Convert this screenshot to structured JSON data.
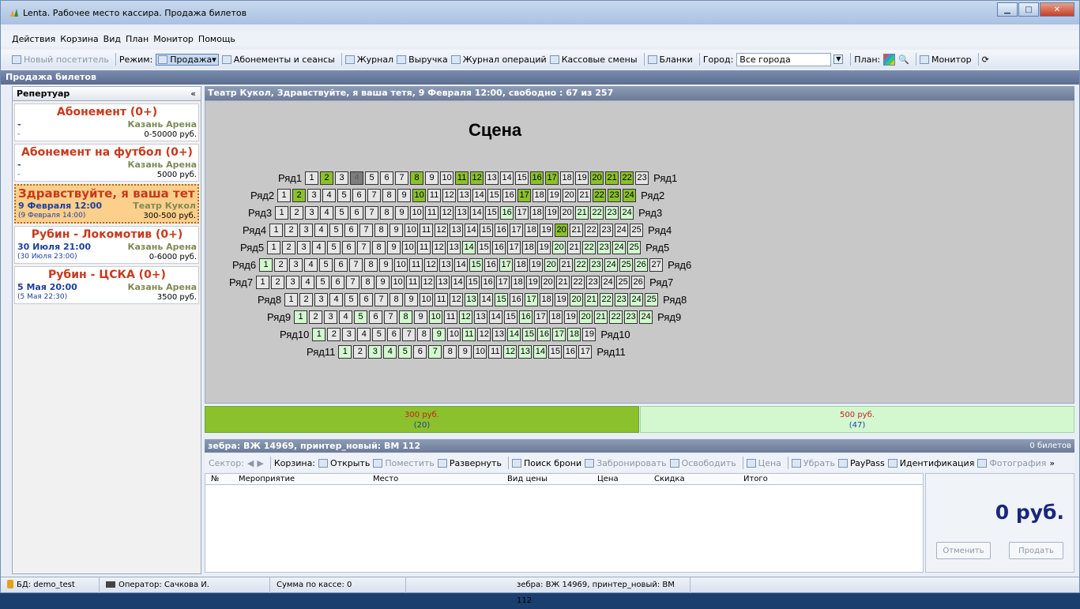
{
  "window": {
    "title": "Lenta. Рабочее место кассира. Продажа билетов"
  },
  "menu": [
    "Действия",
    "Корзина",
    "Вид",
    "План",
    "Монитор",
    "Помощь"
  ],
  "toolbar": {
    "new_visitor": "Новый посетитель",
    "mode_label": "Режим:",
    "mode_value": "Продажа",
    "subscriptions": "Абонементы и сеансы",
    "journal": "Журнал",
    "revenue": "Выручка",
    "ops_journal": "Журнал операций",
    "shifts": "Кассовые смены",
    "forms": "Бланки",
    "city_label": "Город:",
    "city_value": "Все города",
    "plan_label": "План:",
    "monitor": "Монитор"
  },
  "section_title": "Продажа билетов",
  "repertoire": {
    "title": "Репертуар",
    "collapse": "«",
    "items": [
      {
        "name": "Абонемент (0+)",
        "venue": "Казань Арена",
        "date": "-",
        "sub": "-",
        "price": "0-50000 руб."
      },
      {
        "name": "Абонемент на футбол (0+)",
        "venue": "Казань Арена",
        "date": "-",
        "sub": "-",
        "price": "5000 руб."
      },
      {
        "name": "Здравствуйте, я ваша тет...",
        "venue": "Театр Кукол",
        "date": "9 Февраля 12:00",
        "sub": "(9 Февраля 14:00)",
        "price": "300-500 руб.",
        "selected": true
      },
      {
        "name": "Рубин - Локомотив (0+)",
        "venue": "Казань Арена",
        "date": "30 Июля 21:00",
        "sub": "(30 Июля 23:00)",
        "price": "0-6000 руб."
      },
      {
        "name": "Рубин - ЦСКА (0+)",
        "venue": "Казань Арена",
        "date": "5 Мая 20:00",
        "sub": "(5 Мая 22:30)",
        "price": "3500 руб."
      }
    ]
  },
  "hall": {
    "header": "Театр Кукол, Здравствуйте, я ваша тетя, 9 Февраля 12:00, свободно : 67 из 257",
    "scene": "Сцена",
    "rows": [
      {
        "label": "Ряд1",
        "seats": "ngnxnnngnnggnnnggnngggn"
      },
      {
        "label": "Ряд2",
        "seats": "ngnnnnnnngnnnnnngnnnnggg"
      },
      {
        "label": "Ряд3",
        "seats": "nnnnnnnnnnnnnnnlnnnnllll"
      },
      {
        "label": "Ряд4",
        "seats": "nnnnnnnnnnnnnnnnnnngnnnnn"
      },
      {
        "label": "Ряд5",
        "seats": "nnnnnnnnnnnnnlnnnnnlnllll"
      },
      {
        "label": "Ряд6",
        "seats": "lnnnnnnnnnnnnnlnlnnlnllllln"
      },
      {
        "label": "Ряд7",
        "seats": "nnnnnnnnnnnnnnnnnnnnnnnnnn"
      },
      {
        "label": "Ряд8",
        "seats": "nnnnnnnnnnnnlnlnlnnllllll"
      },
      {
        "label": "Ряд9",
        "seats": "lnnnlnnlnlnlnnnlnnnlllll"
      },
      {
        "label": "Ряд10",
        "seats": "lnnnnnnnlnlnnllllln"
      },
      {
        "label": "Ряд11",
        "seats": "lnlllnlnnnnlllnnn"
      }
    ]
  },
  "prices": [
    {
      "value": "300 руб.",
      "count": "(20)",
      "color": "#8bc12c"
    },
    {
      "value": "500 руб.",
      "count": "(47)",
      "color": "#d3f8d0"
    }
  ],
  "cart": {
    "header": "зебра: ВЖ 14969, принтер_новый: ВМ 112",
    "tickets": "0 билетов",
    "sector_label": "Сектор:",
    "basket_label": "Корзина:",
    "open": "Открыть",
    "place": "Поместить",
    "expand": "Развернуть",
    "search": "Поиск брони",
    "reserve": "Забронировать",
    "release": "Освободить",
    "price": "Цена",
    "remove": "Убрать",
    "paypass": "PayPass",
    "ident": "Идентификация",
    "photo": "Фотография",
    "more": "»",
    "columns": [
      "№",
      "Мероприятие",
      "Место",
      "Вид цены",
      "Цена",
      "Скидка",
      "Итого"
    ],
    "total": "0 руб.",
    "cancel": "Отменить",
    "sell": "Продать"
  },
  "status": {
    "db": "БД: demo_test",
    "operator": "Оператор: Сачкова И.",
    "sum": "Сумма по кассе: 0",
    "printer": "зебра: ВЖ 14969, принтер_новый: ВМ 112"
  }
}
